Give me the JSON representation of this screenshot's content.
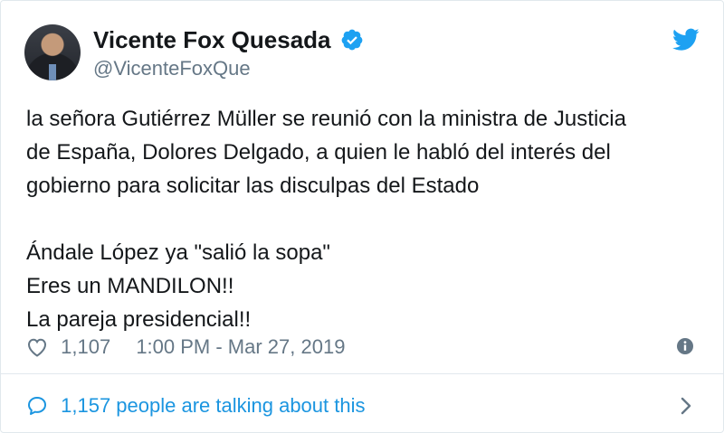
{
  "author": {
    "display_name": "Vicente Fox Quesada",
    "handle": "@VicenteFoxQue",
    "verified": true
  },
  "tweet": {
    "paragraph1": [
      "la señora Gutiérrez Müller se reunió con la ministra de Justicia",
      "de España, Dolores Delgado, a quien le habló del interés del",
      "gobierno para solicitar las disculpas del Estado"
    ],
    "paragraph2": [
      "Ándale López ya \"salió la sopa\"",
      "Eres un MANDILON!!",
      "La pareja presidencial!!"
    ]
  },
  "meta": {
    "likes": "1,107",
    "timestamp": "1:00 PM - Mar 27, 2019"
  },
  "conversation": {
    "label": "1,157 people are talking about this"
  },
  "icons": {
    "brand": "twitter-bird-icon",
    "verified": "verified-badge-icon",
    "like": "heart-icon",
    "info": "info-icon",
    "conversation": "speech-bubble-icon",
    "chevron": "chevron-right-icon"
  },
  "colors": {
    "brand_blue": "#1da1f2",
    "link_blue": "#1b95e0",
    "text": "#14171a",
    "muted": "#657786",
    "border": "#e1e8ed"
  }
}
